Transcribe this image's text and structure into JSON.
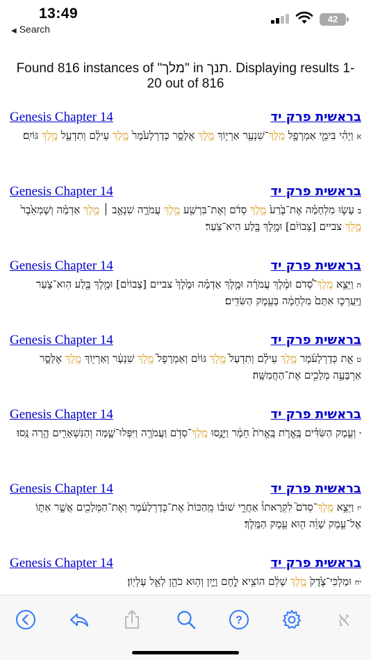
{
  "status": {
    "time": "13:49",
    "back_label": "Search",
    "battery": "42"
  },
  "summary": "Found 816 instances of \"מלך\" in תנך. Displaying results 1-20 out of 816",
  "colors": {
    "link": "#0000cc",
    "highlight": "#d89a1e",
    "toolbar_icon": "#3478f6"
  },
  "results": [
    {
      "ref_en": "Genesis Chapter 14",
      "ref_he": "בראשית פרק יד",
      "num": "א",
      "segments": [
        {
          "t": "וַיְהִ֗י בִּימֵ֛י אַמְרָפֶ֥ל "
        },
        {
          "t": "מֶֽלֶךְ",
          "h": true
        },
        {
          "t": "־שִׁנְעָ֖ר אַרְי֣וֹךְ "
        },
        {
          "t": "מֶ֣לֶךְ",
          "h": true
        },
        {
          "t": " אֶלָּסָ֑ר כְּדָרְלָעֹ֙מֶר֙ "
        },
        {
          "t": "מֶ֣לֶךְ",
          "h": true
        },
        {
          "t": " עֵילָ֔ם וְתִדְעָ֖ל "
        },
        {
          "t": "מֶ֥לֶךְ",
          "h": true
        },
        {
          "t": " גּוֹיִֽם׃"
        }
      ]
    },
    {
      "ref_en": "Genesis Chapter 14",
      "ref_he": "בראשית פרק יד",
      "num": "ב",
      "segments": [
        {
          "t": "עָשׂ֣וּ מִלְחָמָ֗ה אֶת־בֶּ֙רַע֙ "
        },
        {
          "t": "מֶ֣לֶךְ",
          "h": true
        },
        {
          "t": " סְדֹ֔ם וְאֶת־בִּרְשַׁ֖ע "
        },
        {
          "t": "מֶ֣לֶךְ",
          "h": true
        },
        {
          "t": " עֲמֹרָ֑ה שִׁנְאָ֣ב ׀ "
        },
        {
          "t": "מֶ֣לֶךְ",
          "h": true
        },
        {
          "t": " אַדְמָ֗ה וְשֶׁמְאֵ֙בֶר֙ "
        },
        {
          "t": "מֶ֣לֶךְ",
          "h": true
        },
        {
          "t": " צביים [צְבוֹיִ֔ם] וּמֶ֥לֶךְ בֶּ֖לַע הִיא־צֹֽעַר׃"
        }
      ]
    },
    {
      "ref_en": "Genesis Chapter 14",
      "ref_he": "בראשית פרק יד",
      "num": "ח",
      "segments": [
        {
          "t": "וַיֵּצֵ֣א "
        },
        {
          "t": "מֶֽלֶךְ",
          "h": true
        },
        {
          "t": "־סְ֠דֹם וּמֶ֨לֶךְ עֲמֹרָ֜ה וּמֶ֣לֶךְ אַדְמָ֗ה וּמֶ֙לֶךְ֙ צביים [צְבוֹיִ֔ם] וּמֶ֥לֶךְ בֶּ֖לַע הִוא־צֹ֑עַר וַיַּֽעַרְכ֤וּ אִתָּם֙ מִלְחָמָ֔ה בְּעֵ֖מֶק הַשִּׂדִּֽים׃"
        }
      ]
    },
    {
      "ref_en": "Genesis Chapter 14",
      "ref_he": "בראשית פרק יד",
      "num": "ט",
      "segments": [
        {
          "t": "אֵ֣ת כְּדָרְלָעֹ֜מֶר "
        },
        {
          "t": "מֶ֣לֶךְ",
          "h": true
        },
        {
          "t": " עֵילָ֗ם וְתִדְעָל֙ "
        },
        {
          "t": "מֶ֣לֶךְ",
          "h": true
        },
        {
          "t": " גּוֹיִ֔ם וְאַמְרָפֶל֙ "
        },
        {
          "t": "מֶ֣לֶךְ",
          "h": true
        },
        {
          "t": " שִׁנְעָ֔ר וְאַרְי֖וֹךְ "
        },
        {
          "t": "מֶ֣לֶךְ",
          "h": true
        },
        {
          "t": " אֶלָּסָ֑ר אַרְבָּעָ֥ה מְלָכִ֖ים אֶת־הַחֲמִשָּֽׁה׃"
        }
      ]
    },
    {
      "ref_en": "Genesis Chapter 14",
      "ref_he": "בראשית פרק יד",
      "num": "י",
      "segments": [
        {
          "t": "וְעֵ֣מֶק הַשִּׂדִּ֗ים בֶּֽאֱרֹ֤ת בֶּֽאֱרֹת֙ חֵמָ֔ר וַיָּנֻ֛סוּ "
        },
        {
          "t": "מֶֽלֶךְ",
          "h": true
        },
        {
          "t": "־סְדֹ֥ם וַעֲמֹרָ֖ה וַיִּפְּלוּ־שָׁ֑מָּה וְהַנִּשְׁאָרִ֖ים הֶ֥רָה נָּֽסוּ׃"
        }
      ]
    },
    {
      "ref_en": "Genesis Chapter 14",
      "ref_he": "בראשית פרק יד",
      "num": "יז",
      "segments": [
        {
          "t": "וַיֵּצֵ֣א "
        },
        {
          "t": "מֶֽלֶךְ",
          "h": true
        },
        {
          "t": "־סְדֹם֮ לִקְרָאתוֹ֒ אַחֲרֵ֣י שׁוּב֗וֹ מֵֽהַכּוֹת֙ אֶת־כְּדָרְלָעֹ֔מֶר וְאֶת־הַמְּלָכִ֖ים אֲשֶׁ֣ר אִתּ֑וֹ אֶל־עֵ֣מֶק שָׁוֵ֔ה ה֖וּא עֵ֥מֶק הַמֶּֽלֶךְ׃"
        }
      ]
    },
    {
      "ref_en": "Genesis Chapter 14",
      "ref_he": "בראשית פרק יד",
      "num": "יח",
      "segments": [
        {
          "t": "וּמַלְכִּי־צֶ֙דֶק֙ "
        },
        {
          "t": "מֶ֣לֶךְ",
          "h": true
        },
        {
          "t": " שָׁלֵ֔ם הוֹצִ֖יא לֶ֣חֶם וָיָ֑יִן וְה֥וּא כֹהֵ֖ן לְאֵ֥ל עֶלְיֽוֹן׃"
        }
      ]
    }
  ],
  "toolbar": {
    "buttons": [
      {
        "name": "back-circle-icon"
      },
      {
        "name": "reply-icon"
      },
      {
        "name": "share-icon"
      },
      {
        "name": "search-icon"
      },
      {
        "name": "help-icon"
      },
      {
        "name": "gear-icon"
      }
    ],
    "aleph_label": "א"
  }
}
